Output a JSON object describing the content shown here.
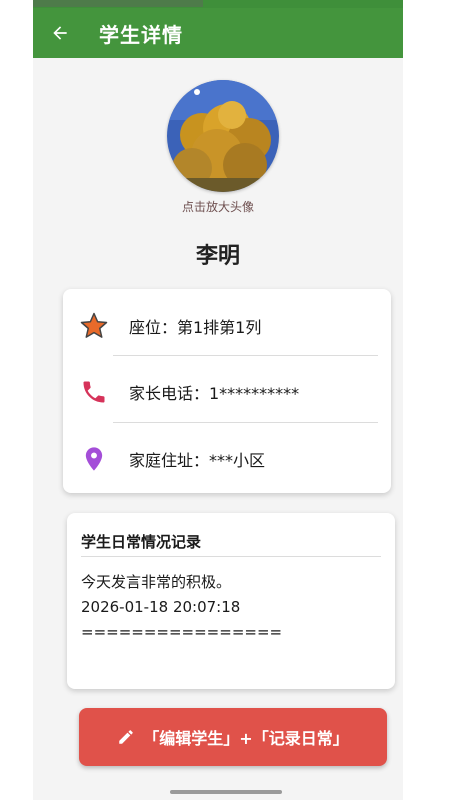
{
  "appbar": {
    "title": "学生详情",
    "back_icon": "arrow-left-icon",
    "color": "#44953d"
  },
  "avatar": {
    "hint": "点击放大头像"
  },
  "student": {
    "name": "李明"
  },
  "info": [
    {
      "icon": "star-icon",
      "icon_color": "#e06a2c",
      "text": "座位：第1排第1列"
    },
    {
      "icon": "phone-icon",
      "icon_color": "#d6335a",
      "text": "家长电话：1**********"
    },
    {
      "icon": "location-pin-icon",
      "icon_color": "#a44ed8",
      "text": "家庭住址：***小区"
    }
  ],
  "record": {
    "title": "学生日常情况记录",
    "lines": [
      "今天发言非常的积极。",
      "2026-01-18 20:07:18",
      "================"
    ]
  },
  "action": {
    "label": "「编辑学生」+「记录日常」",
    "icon": "pencil-icon",
    "color": "#e0524a"
  }
}
